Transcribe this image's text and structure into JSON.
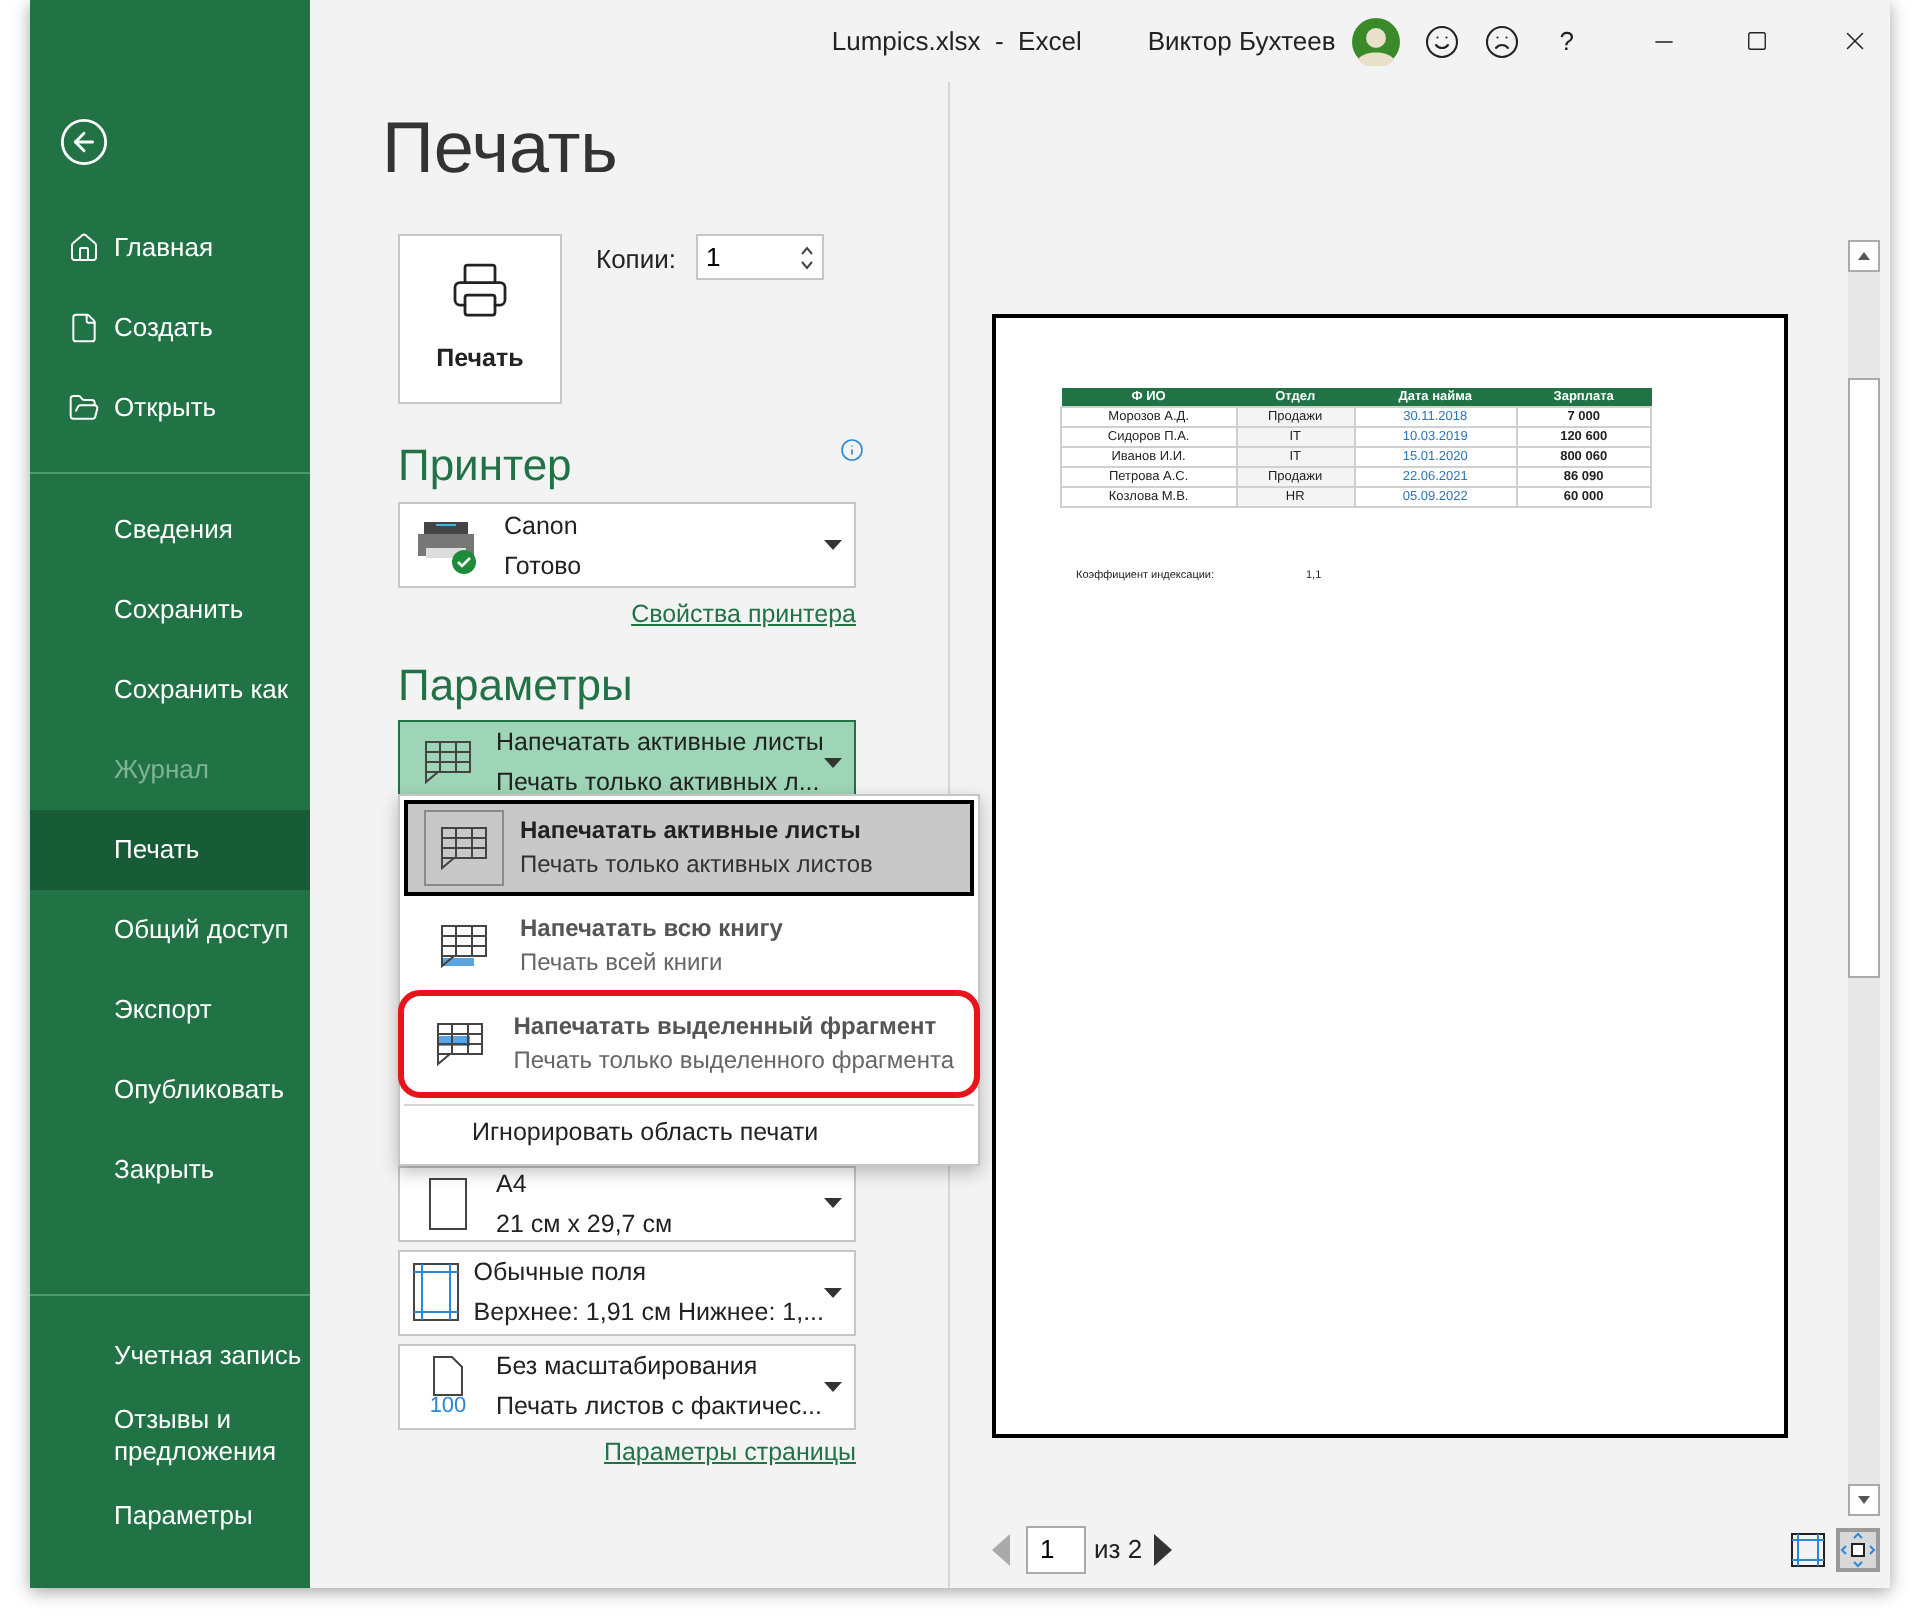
{
  "window": {
    "title": "Lumpics.xlsx  -  Excel",
    "user": "Виктор Бухтеев",
    "help": "?"
  },
  "sidebar": {
    "groups": [
      {
        "items": [
          {
            "label": "Главная",
            "kind": "home",
            "selected": false,
            "disabled": false
          },
          {
            "label": "Создать",
            "kind": "new",
            "selected": false,
            "disabled": false
          },
          {
            "label": "Открыть",
            "kind": "open",
            "selected": false,
            "disabled": false
          }
        ]
      },
      {
        "items": [
          {
            "label": "Сведения",
            "kind": "plain",
            "selected": false,
            "disabled": false
          },
          {
            "label": "Сохранить",
            "kind": "plain",
            "selected": false,
            "disabled": false
          },
          {
            "label": "Сохранить как",
            "kind": "plain",
            "selected": false,
            "disabled": false
          },
          {
            "label": "Журнал",
            "kind": "plain",
            "selected": false,
            "disabled": true
          },
          {
            "label": "Печать",
            "kind": "plain",
            "selected": true,
            "disabled": false
          },
          {
            "label": "Общий доступ",
            "kind": "plain",
            "selected": false,
            "disabled": false
          },
          {
            "label": "Экспорт",
            "kind": "plain",
            "selected": false,
            "disabled": false
          },
          {
            "label": "Опубликовать",
            "kind": "plain",
            "selected": false,
            "disabled": false
          },
          {
            "label": "Закрыть",
            "kind": "plain",
            "selected": false,
            "disabled": false
          }
        ]
      },
      {
        "items": [
          {
            "label": "Учетная запись",
            "kind": "plain",
            "selected": false,
            "disabled": false
          },
          {
            "label": "Отзывы и предложения",
            "kind": "plain",
            "selected": false,
            "disabled": false
          },
          {
            "label": "Параметры",
            "kind": "plain",
            "selected": false,
            "disabled": false
          }
        ]
      }
    ]
  },
  "page_title": "Печать",
  "print_button": {
    "label": "Печать"
  },
  "copies": {
    "label": "Копии:",
    "value": "1"
  },
  "printer": {
    "heading": "Принтер",
    "name": "Canon",
    "status": "Готово",
    "link": "Свойства принтера"
  },
  "settings": {
    "heading": "Параметры",
    "items": [
      {
        "kind": "sheets",
        "title": "Напечатать активные листы",
        "subtitle": "Печать только активных л...",
        "open": true
      },
      {
        "kind": "paper",
        "title": "A4",
        "subtitle": "21 см x 29,7 см",
        "open": false
      },
      {
        "kind": "margins",
        "title": "Обычные поля",
        "subtitle": "Верхнее: 1,91 см Нижнее: 1,...",
        "open": false
      },
      {
        "kind": "scaling",
        "title": "Без масштабирования",
        "subtitle": "Печать листов с фактичес...",
        "badge": "100",
        "open": false
      }
    ],
    "link": "Параметры страницы"
  },
  "menu": {
    "items": [
      {
        "kind": "active_sheets",
        "title": "Напечатать активные листы",
        "subtitle": "Печать только активных листов",
        "selected": true,
        "highlighted": false
      },
      {
        "kind": "workbook",
        "title": "Напечатать всю книгу",
        "subtitle": "Печать всей книги",
        "selected": false,
        "highlighted": false
      },
      {
        "kind": "selection",
        "title": "Напечатать выделенный фрагмент",
        "subtitle": "Печать только выделенного фрагмента",
        "selected": false,
        "highlighted": true
      }
    ],
    "footer": "Игнорировать область печати"
  },
  "preview": {
    "table": {
      "columns": [
        "Ф ИО",
        "Отдел",
        "Дата найма",
        "Зарплата"
      ],
      "rows": [
        [
          "Морозов А.Д.",
          "Продажи",
          "30.11.2018",
          "7 000"
        ],
        [
          "Сидоров П.А.",
          "IT",
          "10.03.2019",
          "120 600"
        ],
        [
          "Иванов И.И.",
          "IT",
          "15.01.2020",
          "800 060"
        ],
        [
          "Петрова А.С.",
          "Продажи",
          "22.06.2021",
          "86 090"
        ],
        [
          "Козлова М.В.",
          "HR",
          "05.09.2022",
          "60 000"
        ]
      ]
    },
    "note_label": "Коэффициент индексации:",
    "note_value": "1,1"
  },
  "pager": {
    "page": "1",
    "of": "из 2"
  }
}
